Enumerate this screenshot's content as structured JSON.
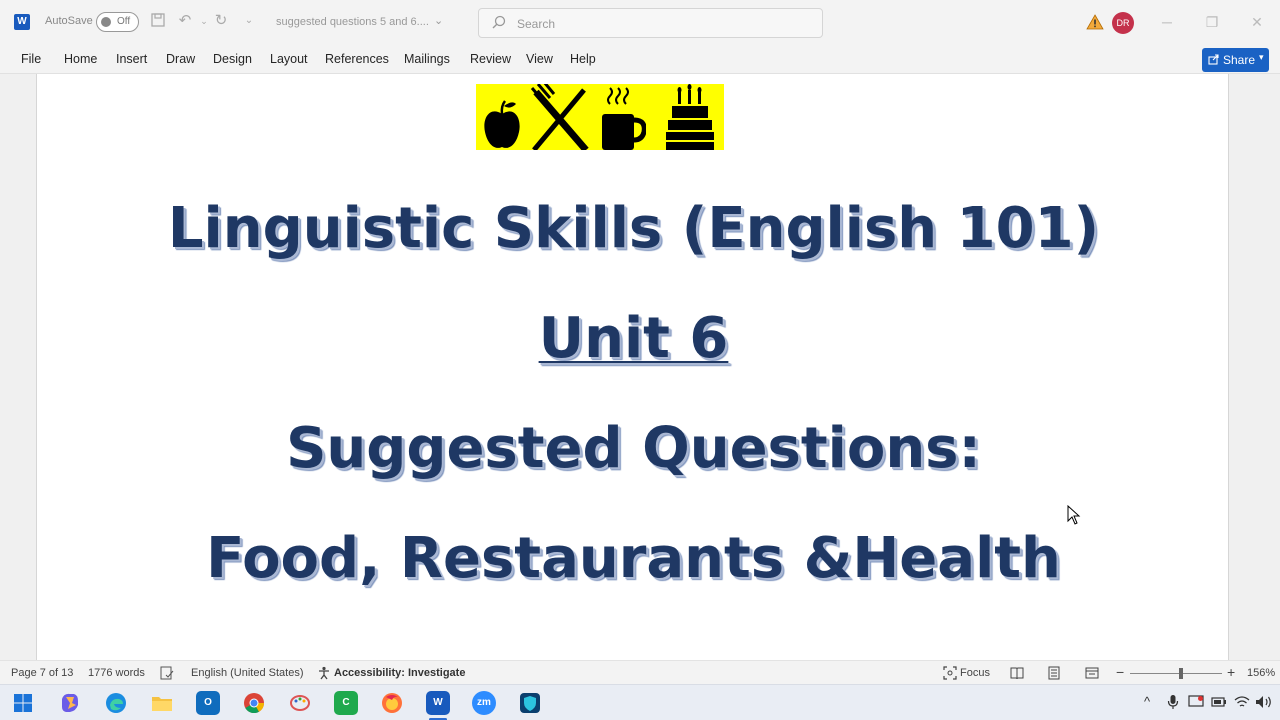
{
  "titlebar": {
    "app_badge": "W",
    "autosave_label": "AutoSave",
    "autosave_state": "Off",
    "document_title": "suggested questions 5 and 6....",
    "search_placeholder": "Search",
    "user_initials": "DR"
  },
  "ribbon": {
    "tabs": [
      "File",
      "Home",
      "Insert",
      "Draw",
      "Design",
      "Layout",
      "References",
      "Mailings",
      "Review",
      "View",
      "Help"
    ],
    "share_label": "Share"
  },
  "document": {
    "line1": "Linguistic Skills (English 101)",
    "line2": "Unit  6",
    "line3": "Suggested Questions:",
    "line4": "Food, Restaurants &Health",
    "banner_icons": [
      "apple-icon",
      "fork-knife-icon",
      "coffee-cup-icon",
      "birthday-cake-icon"
    ]
  },
  "statusbar": {
    "page": "Page 7 of 13",
    "words": "1776 words",
    "language": "English (United States)",
    "accessibility": "Accessibility: Investigate",
    "focus": "Focus",
    "zoom": "156%",
    "zoom_level": 0.55
  },
  "taskbar": {
    "apps": [
      "start",
      "copilot",
      "edge",
      "file-explorer",
      "outlook",
      "chrome",
      "paint",
      "camtasia",
      "firefox",
      "word",
      "zoom",
      "shield-app"
    ],
    "zoom_label": "zm",
    "outlook_label": "O",
    "word_label": "W"
  },
  "colors": {
    "heading": "#1f3864",
    "banner": "#ffff00",
    "share": "#1a62c4",
    "avatar": "#c4314b"
  }
}
